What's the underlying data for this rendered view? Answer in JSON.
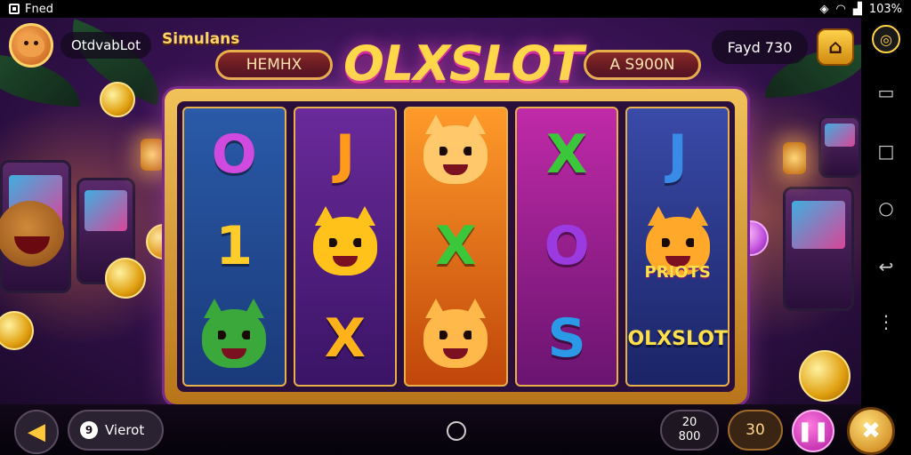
{
  "status_bar": {
    "app_label": "Fned",
    "battery_text": "103%"
  },
  "header": {
    "brand": "OtdvabLot",
    "simulator_label": "Simulans",
    "title": "OLXSLOT",
    "banner_left": "HEMHX",
    "banner_right": "A S900N",
    "coins_label": "Fayd 730",
    "home_button_icon": "home-icon"
  },
  "reels": [
    {
      "symbols": [
        {
          "kind": "text",
          "text": "O",
          "color": "#d04ae0"
        },
        {
          "kind": "text",
          "text": "1",
          "color": "#ffcc2a"
        },
        {
          "kind": "fox",
          "color": "#3aa83a"
        }
      ]
    },
    {
      "symbols": [
        {
          "kind": "text",
          "text": "J",
          "color": "#ff9a1a"
        },
        {
          "kind": "fox",
          "color": "#ffc21a"
        },
        {
          "kind": "text",
          "text": "X",
          "color": "#ffb21a"
        }
      ]
    },
    {
      "symbols": [
        {
          "kind": "fox",
          "color": "#ffc86a"
        },
        {
          "kind": "text",
          "text": "X",
          "color": "#3ac83a"
        },
        {
          "kind": "fox",
          "color": "#ffb84a"
        }
      ]
    },
    {
      "symbols": [
        {
          "kind": "text",
          "text": "X",
          "color": "#3ac83a"
        },
        {
          "kind": "text",
          "text": "O",
          "color": "#9a3ae0"
        },
        {
          "kind": "text",
          "text": "S",
          "color": "#2a9ae8"
        }
      ]
    },
    {
      "symbols": [
        {
          "kind": "text",
          "text": "J",
          "color": "#3a8ae8"
        },
        {
          "kind": "fox",
          "color": "#ffa82a",
          "tag": "PRIOTS"
        },
        {
          "kind": "text",
          "text": "OLXSLOT",
          "color": "#ffe04a"
        }
      ]
    }
  ],
  "bottom_bar": {
    "back_icon": "arrow-left-icon",
    "mode_label": "Vierot",
    "bet_top": "20",
    "bet_bottom": "800",
    "lines_value": "30",
    "pause_icon": "pause-icon",
    "spin_icon": "spin-icon"
  },
  "colors": {
    "accent_gold": "#ffd24a",
    "accent_pink": "#d0319a",
    "background": "#3a1356"
  }
}
